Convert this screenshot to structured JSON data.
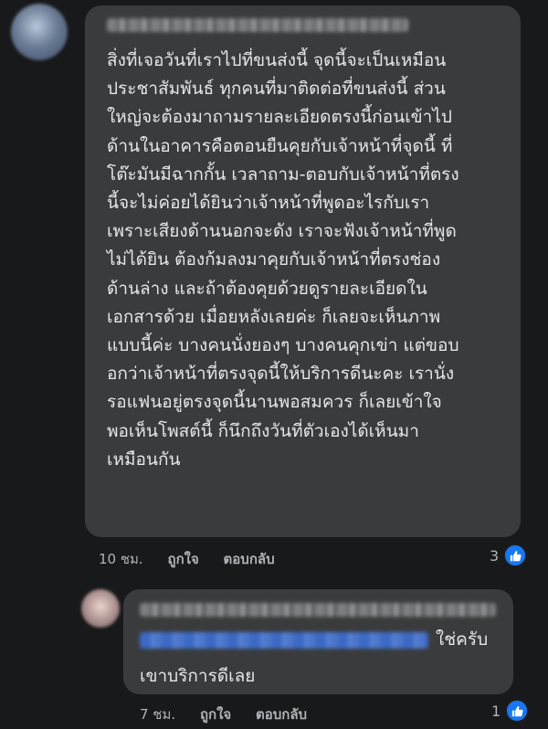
{
  "comment": {
    "text": "สิ่งที่เจอวันที่เราไปที่ขนส่งนี้ จุดนี้จะเป็นเหมือน\nประชาสัมพันธ์ ทุกคนที่มาติดต่อที่ขนส่งนี้ ส่วน\nใหญ่จะต้องมาถามรายละเอียดตรงนี้ก่อนเข้าไป\nด้านในอาคารคือตอนยืนคุยกับเจ้าหน้าที่จุดนี้ ที่\nโต๊ะมันมีฉากกั้น เวลาถาม-ตอบกับเจ้าหน้าที่ตรง\nนี้จะไม่ค่อยได้ยินว่าเจ้าหน้าที่พูดอะไรกับเรา\nเพราะเสียงด้านนอกจะดัง เราจะฟังเจ้าหน้าที่พูด\nไม่ได้ยิน ต้องก้มลงมาคุยกับเจ้าหน้าที่ตรงช่อง\nด้านล่าง และถ้าต้องคุยด้วยดูรายละเอียดใน\nเอกสารด้วย เมื่อยหลังเลยค่ะ ก็เลยจะเห็นภาพ\nแบบนี้ค่ะ บางคนนั่งยองๆ บางคนคุกเข่า แต่ขอบ\nอกว่าเจ้าหน้าที่ตรงจุดนี้ให้บริการดีนะคะ เรานั่ง\nรอแฟนอยู่ตรงจุดนี้นานพอสมควร ก็เลยเข้าใจ\nพอเห็นโพสต์นี้ ก็นึกถึงวันที่ตัวเองได้เห็นมา\nเหมือนกัน",
    "time": "10 ชม.",
    "like_label": "ถูกใจ",
    "reply_label": "ตอบกลับ",
    "reaction_count": "3"
  },
  "reply": {
    "text_line1": "ใช่ครับ",
    "text_line2": "เขาบริการดีเลย",
    "time": "7 ชม.",
    "like_label": "ถูกใจ",
    "reply_label": "ตอบกลับ",
    "reaction_count": "1"
  },
  "colors": {
    "background": "#18191a",
    "bubble": "#3a3b3c",
    "text": "#e4e6eb",
    "meta": "#b0b3b8",
    "like_blue": "#1877f2"
  },
  "icons": {
    "reaction": "thumbs-up-icon"
  }
}
